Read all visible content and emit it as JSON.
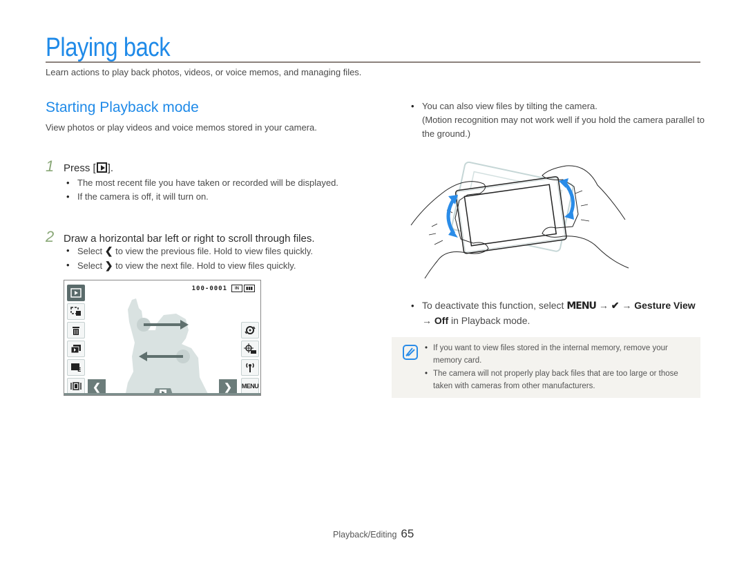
{
  "header": {
    "title": "Playing back",
    "intro": "Learn actions to play back photos, videos, or voice memos, and managing files."
  },
  "section": {
    "title": "Starting Playback mode",
    "description": "View photos or play videos and voice memos stored in your camera."
  },
  "steps": [
    {
      "number": "1",
      "text_before": "Press [",
      "key_icon": "playback-key-icon",
      "text_after": "].",
      "bullets": [
        "The most recent file you have taken or recorded will be displayed.",
        "If the camera is off, it will turn on."
      ]
    },
    {
      "number": "2",
      "text": "Draw a horizontal bar left or right to scroll through files.",
      "bullets": [
        {
          "before": "Select",
          "icon": "chevron-left-icon",
          "glyph": "❮",
          "after": "to view the previous file. Hold to view files quickly."
        },
        {
          "before": "Select",
          "icon": "chevron-right-icon",
          "glyph": "❯",
          "after": "to view the next file. Hold to view files quickly."
        }
      ]
    }
  ],
  "camera_screen": {
    "file_number": "100-0001",
    "memory_indicator": "IN",
    "battery": "full",
    "left_buttons": [
      "playback-mode",
      "smart-album",
      "delete",
      "slide-show",
      "edit",
      "view-mode"
    ],
    "right_buttons": [
      "rotate",
      "face-recognition",
      "wireless"
    ],
    "menu_label": "MENU",
    "prev_glyph": "❮",
    "next_glyph": "❯"
  },
  "right_column": {
    "tilt_bullet": {
      "line1": "You can also view files by tilting the camera.",
      "line2": "(Motion recognition may not work well if you hold the camera parallel to the ground.)"
    },
    "deactivate": {
      "prefix": "To deactivate this function, select",
      "menu_glyph": "MENU",
      "arrow": "→",
      "check_glyph": "❤",
      "gesture_view": "Gesture View",
      "off": "Off",
      "suffix": "in Playback mode."
    },
    "note": {
      "items": [
        "If you want to view files stored in the internal memory, remove your memory card.",
        "The camera will not properly play back files that are too large or those taken with cameras from other manufacturers."
      ]
    }
  },
  "footer": {
    "section": "Playback/Editing",
    "page": "65"
  },
  "colors": {
    "accent_blue": "#1f8ae8",
    "step_number_green": "#8aa878",
    "note_bg": "#f4f3ef",
    "rule_gray": "#8b817c"
  }
}
